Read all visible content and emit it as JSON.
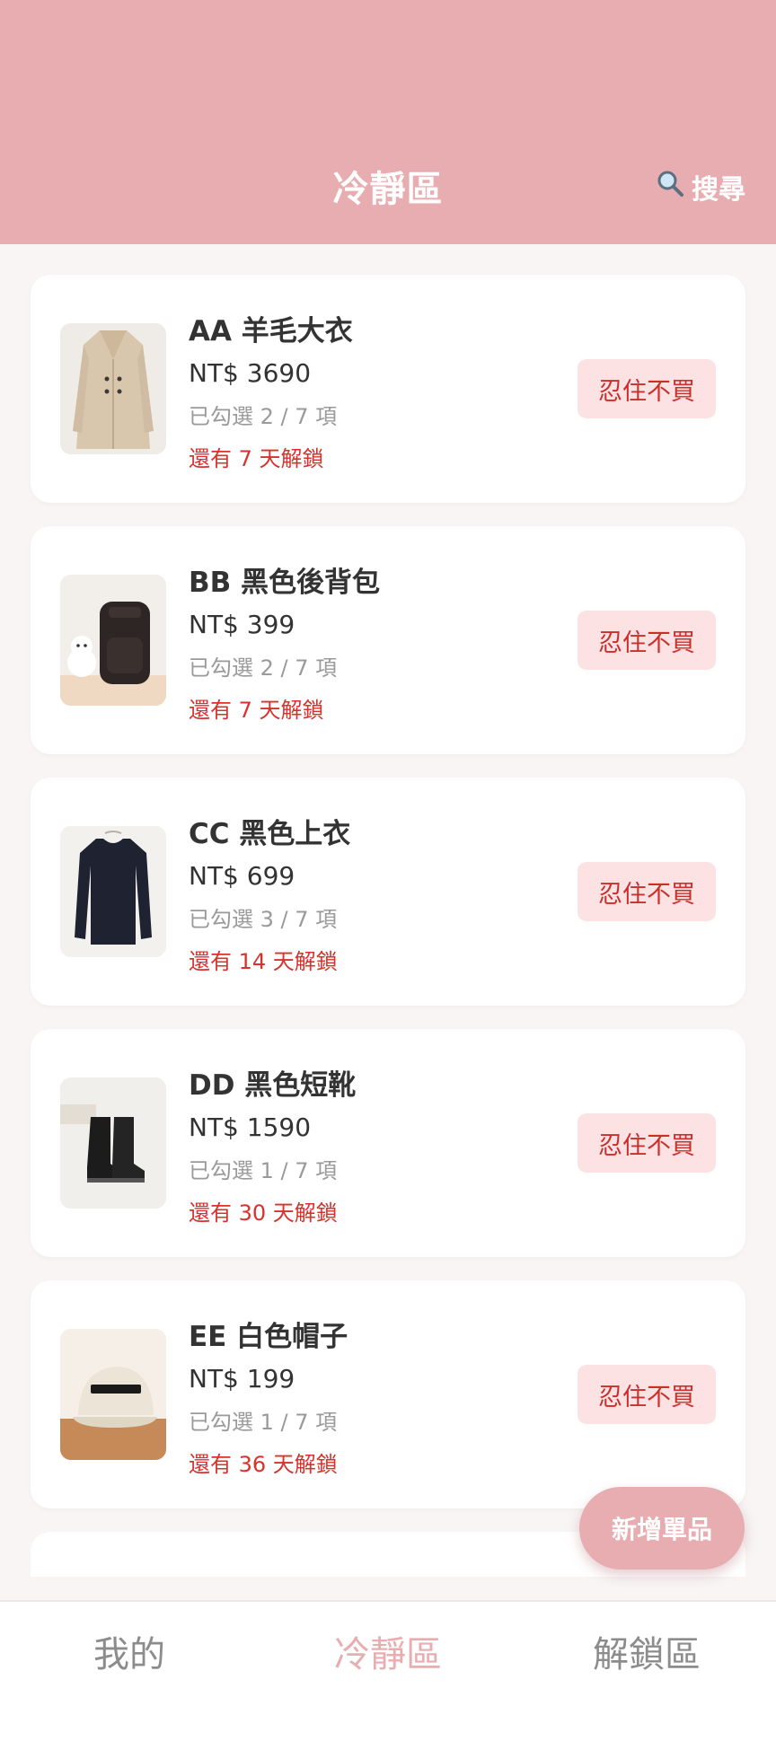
{
  "header": {
    "title": "冷靜區",
    "search_icon": "magnifier-icon",
    "search_label": "搜尋"
  },
  "colors": {
    "header_bg": "#e8adb0",
    "accent": "#e8adb0",
    "unlock_red": "#d9312b",
    "button_bg": "#fde2e3",
    "button_text": "#c9302c"
  },
  "items": [
    {
      "name": "AA 羊毛大衣",
      "price": "NT$ 3690",
      "checked": "已勾選 2 / 7 項",
      "unlock": "還有 7 天解鎖",
      "button": "忍住不買",
      "image_icon": "coat-image"
    },
    {
      "name": "BB 黑色後背包",
      "price": "NT$ 399",
      "checked": "已勾選 2 / 7 項",
      "unlock": "還有 7 天解鎖",
      "button": "忍住不買",
      "image_icon": "backpack-image"
    },
    {
      "name": "CC 黑色上衣",
      "price": "NT$ 699",
      "checked": "已勾選 3 / 7 項",
      "unlock": "還有 14 天解鎖",
      "button": "忍住不買",
      "image_icon": "shirt-image"
    },
    {
      "name": "DD 黑色短靴",
      "price": "NT$ 1590",
      "checked": "已勾選 1 / 7 項",
      "unlock": "還有 30 天解鎖",
      "button": "忍住不買",
      "image_icon": "boots-image"
    },
    {
      "name": "EE 白色帽子",
      "price": "NT$ 199",
      "checked": "已勾選 1 / 7 項",
      "unlock": "還有 36 天解鎖",
      "button": "忍住不買",
      "image_icon": "cap-image"
    }
  ],
  "fab": {
    "label": "新增單品"
  },
  "nav": {
    "items": [
      {
        "label": "我的"
      },
      {
        "label": "冷靜區",
        "active": true
      },
      {
        "label": "解鎖區"
      }
    ]
  }
}
